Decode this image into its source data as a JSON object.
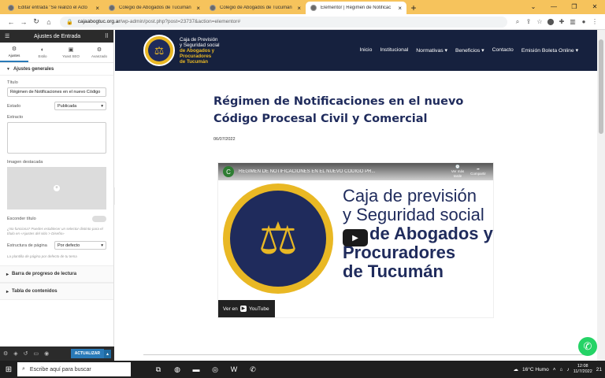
{
  "browser": {
    "tabs": [
      {
        "title": "Editar entrada \"Se realizó el Acto",
        "active": false
      },
      {
        "title": "Colegio de Abogados de Tucumán",
        "active": false
      },
      {
        "title": "Colegio de Abogados de Tucumán",
        "active": false
      },
      {
        "title": "Elementor | Régimen de Notificac",
        "active": true
      }
    ],
    "url_host": "cajaabogtuc.org.ar",
    "url_path": "/wp-admin/post.php?post=23737&action=elementor#"
  },
  "panel": {
    "header": "Ajustes de Entrada",
    "tabs": [
      "Ajustes",
      "Estilo",
      "Yoast SEO",
      "Avanzado"
    ],
    "section_general": "Ajustes generales",
    "title_label": "Título",
    "title_value": "Régimen de Notificaciones en el nuevo Código",
    "status_label": "Estado",
    "status_value": "Publicada",
    "excerpt_label": "Extracto",
    "featured_label": "Imagen destacada",
    "hide_title_label": "Esconder título",
    "hide_title_note": "¿No funciona? Puedes establecer un selector distinto para el título en «Ajustes del sitio > Diseño»",
    "page_layout_label": "Estructura de página",
    "page_layout_value": "Por defecto",
    "page_layout_note": "La plantilla de página por defecto de tu tema",
    "section_progress": "Barra de progreso de lectura",
    "section_toc": "Tabla de contenidos",
    "update_button": "ACTUALIZAR"
  },
  "site": {
    "logo_line1": "Caja de Previsión",
    "logo_line2": "y Seguridad social",
    "logo_line3": "de Abogados y",
    "logo_line4": "Procuradores",
    "logo_line5": "de Tucumán",
    "menu": [
      "Inicio",
      "Institucional",
      "Normativas ▾",
      "Beneficios ▾",
      "Contacto",
      "Emisión Boleta Online ▾"
    ],
    "article_title": "Régimen de Notificaciones en el nuevo Código Procesal Civil y Comercial",
    "article_date": "06/07/2022",
    "video_channel_initial": "C",
    "video_title": "REGIMEN DE NOTIFICACIONES EN EL NUEVO CODIGO PR...",
    "video_watch_later": "Ver más tarde",
    "video_share": "Compartir",
    "video_text_l1": "Caja de previsión",
    "video_text_l2": "y Seguridad social",
    "video_text_l3": "de Abogados y",
    "video_text_l4": "Procuradores",
    "video_text_l5": "de Tucumán",
    "watch_on": "Ver en",
    "youtube": "YouTube"
  },
  "taskbar": {
    "search_placeholder": "Escribe aquí para buscar",
    "weather": "16°C  Humo",
    "time": "12:08",
    "date": "11/7/2022",
    "notifications": "21"
  }
}
